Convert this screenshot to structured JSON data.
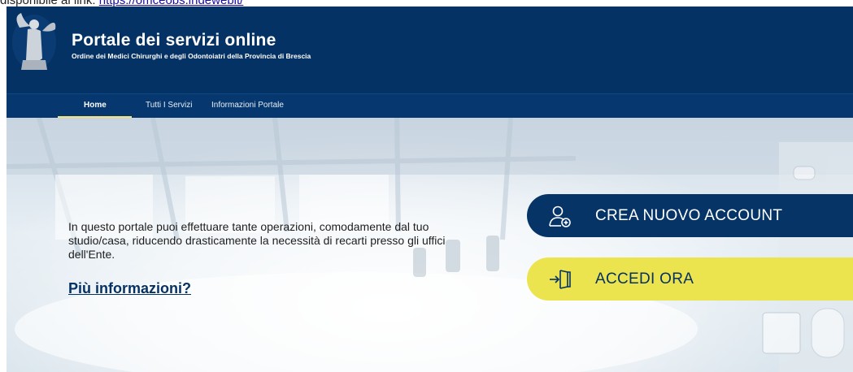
{
  "note": {
    "prefix": "disponibile ai link: ",
    "link_text": "https://omceobs.iridewebit/"
  },
  "header": {
    "title": "Portale dei servizi online",
    "subtitle": "Ordine dei Medici Chirurghi e degli Odontoiatri della Provincia di Brescia"
  },
  "nav": {
    "items": [
      "Home",
      "Tutti I Servizi",
      "Informazioni Portale"
    ],
    "active": "Home"
  },
  "hero": {
    "text": "In questo portale puoi effettuare tante operazioni, comodamente dal tuo studio/casa, riducendo drasticamente la necessità di recarti presso gli uffici dell'Ente.",
    "more_link": "Più informazioni?"
  },
  "buttons": {
    "create_account": "CREA NUOVO ACCOUNT",
    "login": "ACCEDI ORA"
  },
  "icons": {
    "logo": "angel-statue-logo",
    "create": "user-add-icon",
    "login": "login-door-icon"
  },
  "colors": {
    "header_bg": "#053265",
    "nav_underline": "#f2e47a",
    "create_button": "#063466",
    "login_button": "#ece44e"
  }
}
